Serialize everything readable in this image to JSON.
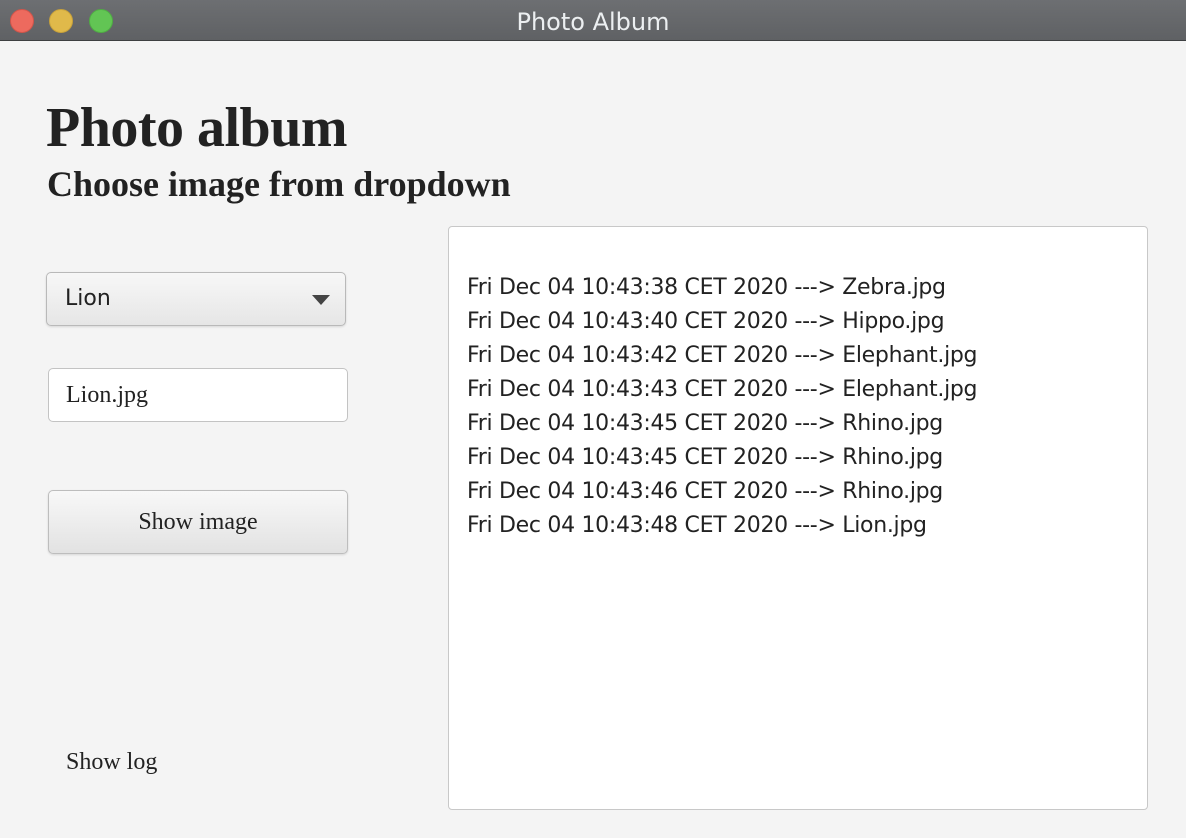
{
  "window": {
    "title": "Photo Album"
  },
  "header": {
    "title": "Photo album",
    "subtitle": "Choose image from dropdown"
  },
  "controls": {
    "dropdown_value": "Lion",
    "filename_value": "Lion.jpg",
    "show_image_label": "Show image",
    "show_log_label": "Show log"
  },
  "log": {
    "entries": [
      "Fri Dec 04 10:43:38 CET 2020 ---> Zebra.jpg",
      "Fri Dec 04 10:43:40 CET 2020 ---> Hippo.jpg",
      "Fri Dec 04 10:43:42 CET 2020 ---> Elephant.jpg",
      "Fri Dec 04 10:43:43 CET 2020 ---> Elephant.jpg",
      "Fri Dec 04 10:43:45 CET 2020 ---> Rhino.jpg",
      "Fri Dec 04 10:43:45 CET 2020 ---> Rhino.jpg",
      "Fri Dec 04 10:43:46 CET 2020 ---> Rhino.jpg",
      "Fri Dec 04 10:43:48 CET 2020 ---> Lion.jpg"
    ]
  },
  "icons": {
    "close": "close-icon",
    "minimize": "minimize-icon",
    "zoom": "zoom-icon",
    "dropdown_arrow": "chevron-down-icon"
  }
}
